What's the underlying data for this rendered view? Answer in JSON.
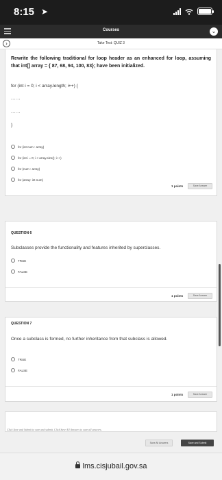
{
  "status_bar": {
    "time": "8:15"
  },
  "app_bar": {
    "title": "Courses"
  },
  "sub_nav": {
    "title": "Take Test: QUIZ 3"
  },
  "question5": {
    "text": "Rewrite the following traditional for loop header as an enhanced for loop, assuming that int[] array = { 87, 68, 94, 100, 83}; have been initialized.",
    "code": [
      "for (int i = 0; i < array.length; i++) {",
      "......",
      "......",
      "}"
    ],
    "options": [
      "for (int num : array)",
      "for (int i = 0; i < array.size(); i++)",
      "for (num : array)",
      "for (array: int num)"
    ],
    "points": "1 points",
    "save_label": "Save Answer"
  },
  "question6": {
    "label": "QUESTION 6",
    "text": "Subclasses provide the functionality and features inherited by superclasses.",
    "options": [
      "TRUE",
      "FALSE"
    ],
    "points": "1 points",
    "save_label": "Save Answer"
  },
  "question7": {
    "label": "QUESTION 7",
    "text": "Once a subclass is formed, no further inheritance from that subclass is allowed.",
    "options": [
      "TRUE",
      "FALSE"
    ],
    "points": "1 points",
    "save_label": "Save Answer"
  },
  "footer": {
    "instructions": "Click Save and Submit to save and submit. Click Save All Answers to save all answers.",
    "save_all_label": "Save All Answers",
    "save_submit_label": "Save and Submit"
  },
  "browser": {
    "url": "lms.cisjubail.gov.sa"
  }
}
